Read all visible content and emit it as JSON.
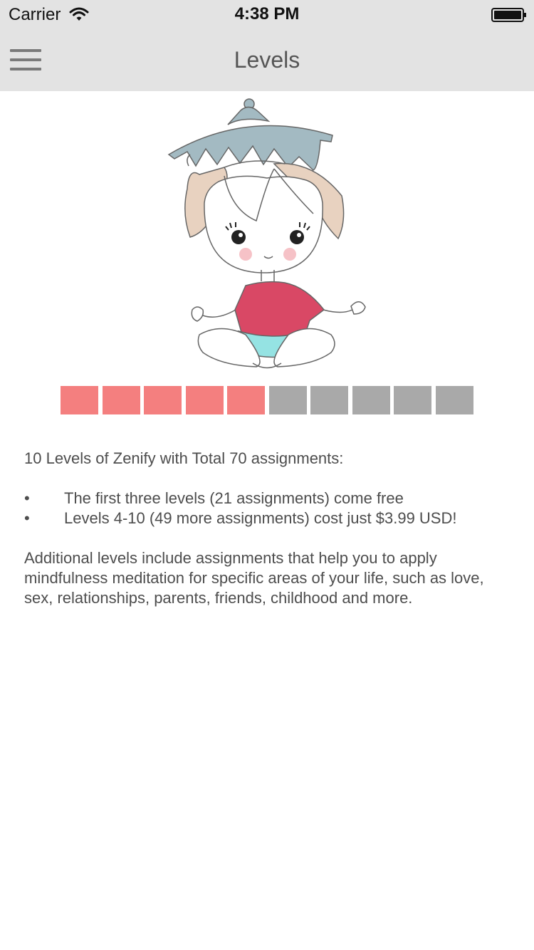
{
  "status_bar": {
    "carrier": "Carrier",
    "time": "4:38 PM",
    "wifi_icon": "wifi-icon",
    "battery_icon": "battery-icon"
  },
  "nav": {
    "title": "Levels",
    "menu_icon": "hamburger-menu-icon"
  },
  "illustration": {
    "name": "meditating-child-illustration"
  },
  "progress": {
    "total_levels": 10,
    "highlighted_levels": 5,
    "active_color": "#f47f7f",
    "inactive_color": "#a9a9a9"
  },
  "content": {
    "intro": "10 Levels of Zenify with Total 70 assignments:",
    "bullets": [
      "The first three levels (21 assignments) come free",
      "Levels 4-10 (49 more assignments) cost just $3.99 USD!"
    ],
    "bullet_glyph": "•",
    "description": "Additional levels include assignments that help you to apply mindfulness meditation for specific areas of your life, such as love, sex, relationships, parents, friends, childhood and more."
  }
}
